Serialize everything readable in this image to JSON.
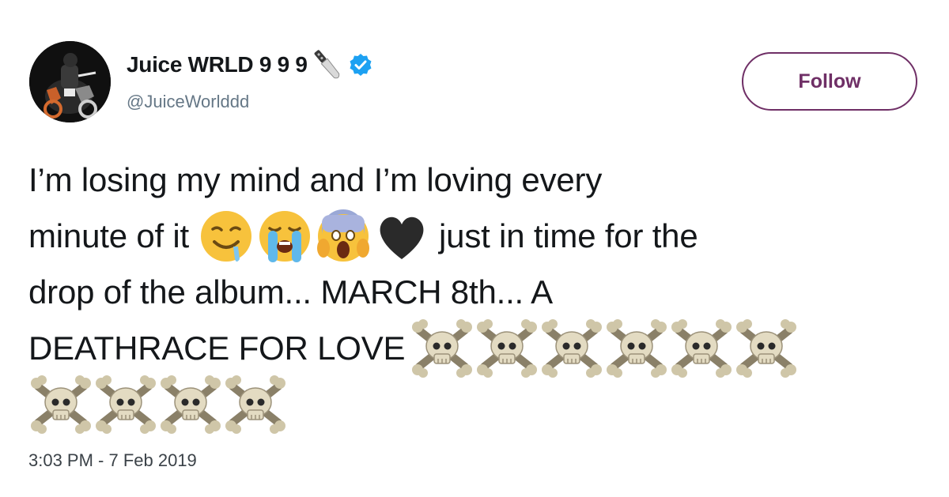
{
  "user": {
    "display_name": "Juice WRLD 9 9 9",
    "handle": "@JuiceWorlddd",
    "verified": true,
    "name_emoji": "knife-icon"
  },
  "follow_button": {
    "label": "Follow",
    "color": "#6f2f66"
  },
  "tweet": {
    "line1": "I’m losing my mind and I’m loving every",
    "line2_before": "minute of it",
    "line2_emojis": [
      "drooling-face-icon",
      "loudly-crying-face-icon",
      "face-screaming-in-fear-icon",
      "black-heart-icon"
    ],
    "line2_after": "just in time for the",
    "line3": "drop of the album... MARCH 8th... A",
    "line4": "DEATHRACE FOR LOVE",
    "skull_emoji_count": 10
  },
  "timestamp": "3:03 PM - 7 Feb 2019"
}
